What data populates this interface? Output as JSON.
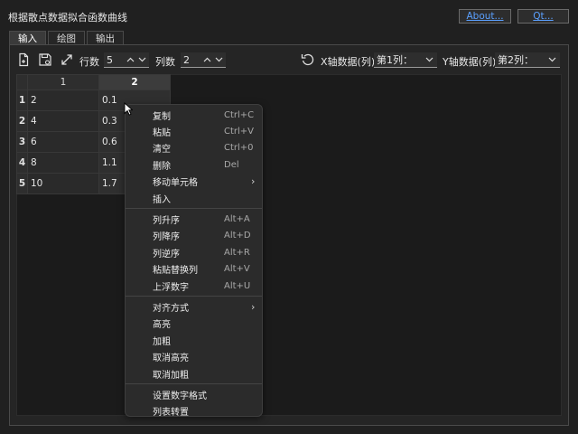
{
  "window": {
    "title": "根据散点数据拟合函数曲线"
  },
  "header": {
    "about_label": "About...",
    "qt_label": "Qt..."
  },
  "tabs": [
    {
      "label": "输入",
      "active": true
    },
    {
      "label": "绘图",
      "active": false
    },
    {
      "label": "输出",
      "active": false
    }
  ],
  "toolbar": {
    "rows_label": "行数",
    "rows_value": "5",
    "cols_label": "列数",
    "cols_value": "2",
    "x_label": "X轴数据(列)",
    "x_value": "第1列：",
    "y_label": "Y轴数据(列)",
    "y_value": "第2列："
  },
  "grid": {
    "columns": [
      "1",
      "2"
    ],
    "rows": [
      {
        "index": "1",
        "c1": "2",
        "c2": "0.1"
      },
      {
        "index": "2",
        "c1": "4",
        "c2": "0.3"
      },
      {
        "index": "3",
        "c1": "6",
        "c2": "0.6"
      },
      {
        "index": "4",
        "c1": "8",
        "c2": "1.1"
      },
      {
        "index": "5",
        "c1": "10",
        "c2": "1.7"
      }
    ]
  },
  "context_menu": {
    "items": [
      {
        "label": "复制",
        "shortcut": "Ctrl+C"
      },
      {
        "label": "粘贴",
        "shortcut": "Ctrl+V"
      },
      {
        "label": "清空",
        "shortcut": "Ctrl+0"
      },
      {
        "label": "删除",
        "shortcut": "Del"
      },
      {
        "label": "移动单元格",
        "shortcut": ""
      },
      {
        "label": "插入",
        "shortcut": ""
      },
      {
        "label": "列升序",
        "shortcut": "Alt+A"
      },
      {
        "label": "列降序",
        "shortcut": "Alt+D"
      },
      {
        "label": "列逆序",
        "shortcut": "Alt+R"
      },
      {
        "label": "粘贴替换列",
        "shortcut": "Alt+V"
      },
      {
        "label": "上浮数字",
        "shortcut": "Alt+U"
      },
      {
        "label": "对齐方式",
        "shortcut": ""
      },
      {
        "label": "高亮",
        "shortcut": ""
      },
      {
        "label": "加粗",
        "shortcut": ""
      },
      {
        "label": "取消高亮",
        "shortcut": ""
      },
      {
        "label": "取消加粗",
        "shortcut": ""
      },
      {
        "label": "设置数字格式",
        "shortcut": ""
      },
      {
        "label": "列表转置",
        "shortcut": ""
      }
    ]
  },
  "icons": {
    "toolbar": [
      "open-file-icon",
      "save-icon",
      "expand-icon",
      "refresh-icon"
    ],
    "menu": [
      "submenu-arrow-icon"
    ]
  }
}
